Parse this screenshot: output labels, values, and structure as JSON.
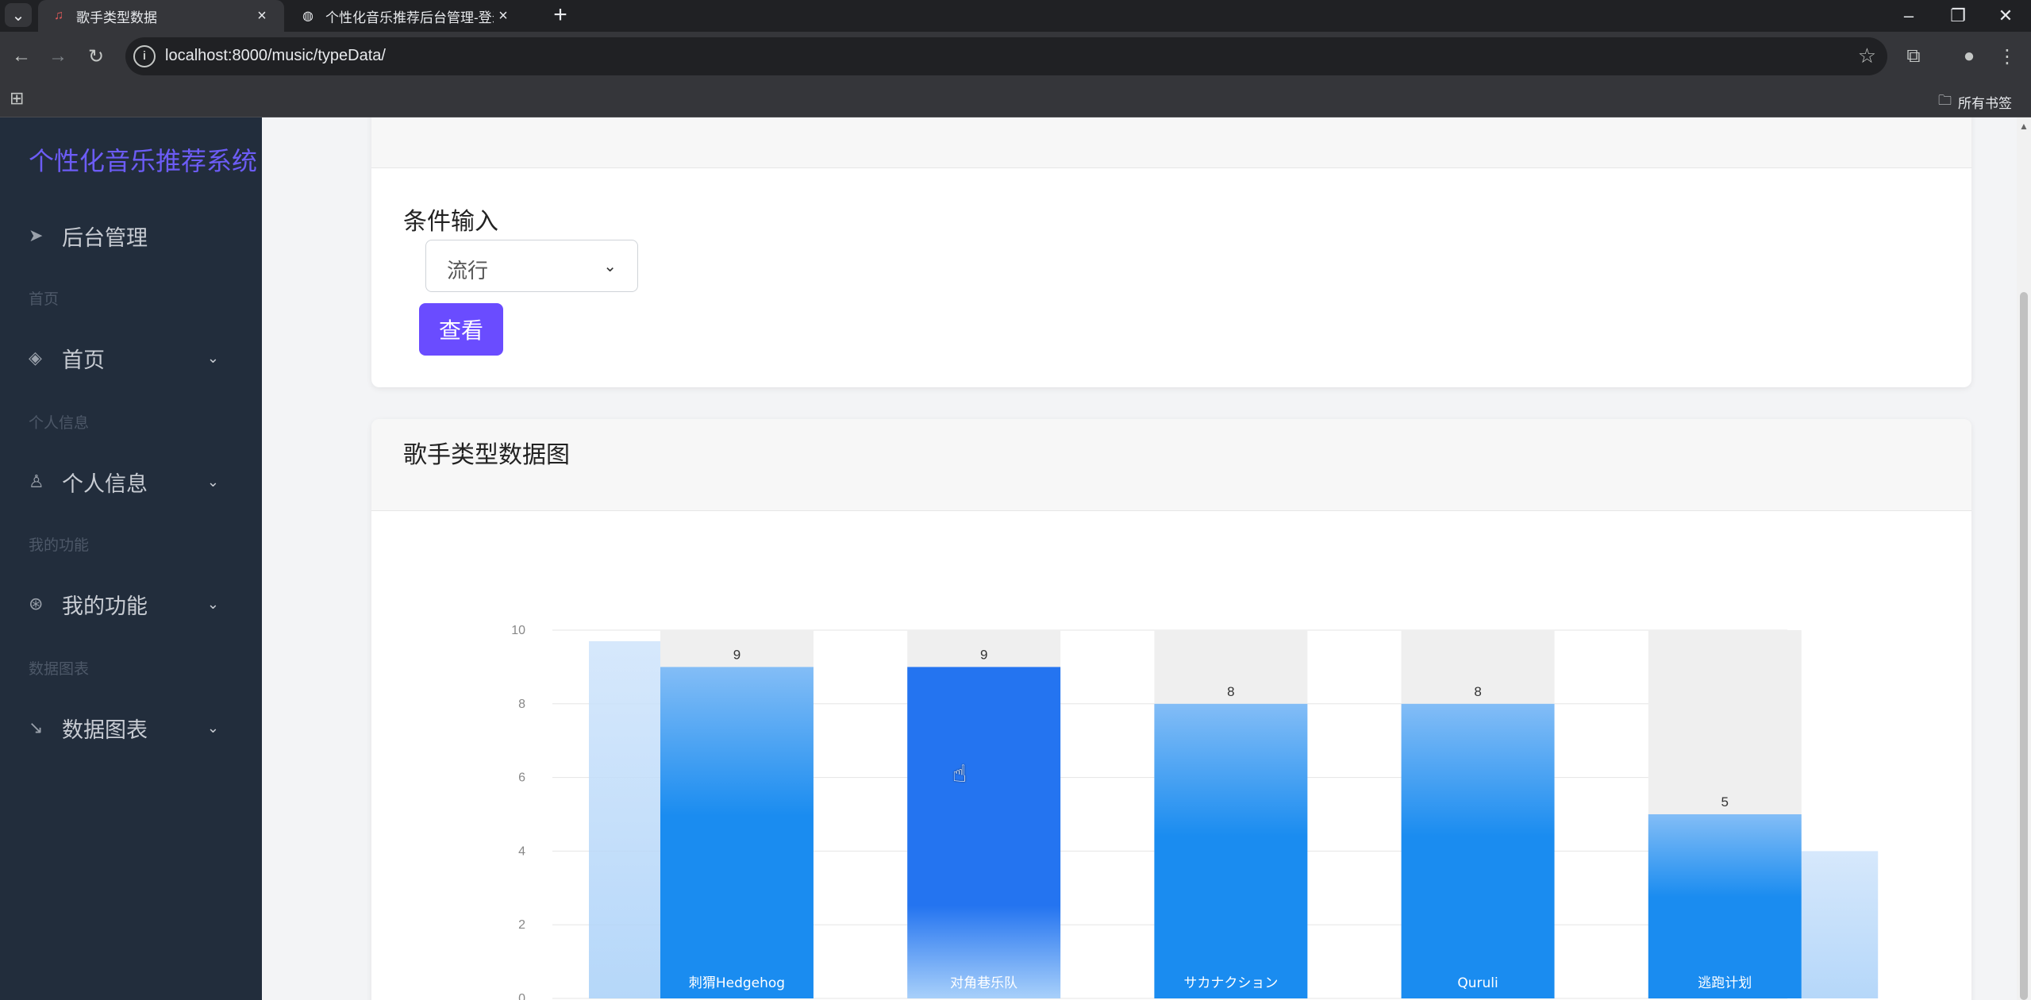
{
  "browser": {
    "tabs": [
      {
        "title": "歌手类型数据",
        "active": true,
        "favicon": "music-app-icon"
      },
      {
        "title": "个性化音乐推荐后台管理-登录",
        "active": false,
        "favicon": "globe-icon"
      }
    ],
    "url": "localhost:8000/music/typeData/",
    "bookmarks_all": "所有书签"
  },
  "sidebar": {
    "brand": "个性化音乐推荐系统",
    "top_item": "后台管理",
    "sections": [
      {
        "header": "首页",
        "item": "首页",
        "icon": "layers-icon"
      },
      {
        "header": "个人信息",
        "item": "个人信息",
        "icon": "user-icon"
      },
      {
        "header": "我的功能",
        "item": "我的功能",
        "icon": "aperture-icon"
      },
      {
        "header": "数据图表",
        "item": "数据图表",
        "icon": "trending-down-icon"
      }
    ]
  },
  "filter": {
    "title": "条件输入",
    "selected": "流行",
    "button": "查看"
  },
  "chart_card": {
    "title": "歌手类型数据图"
  },
  "colors": {
    "accent": "#6a4cff",
    "bar": "#1a8cf0",
    "bar_hover": "#2474f0",
    "sidebar": "#222d3c"
  },
  "chart_data": {
    "type": "bar",
    "categories": [
      "刺猬Hedgehog",
      "对角巷乐队",
      "サカナクション",
      "Quruli",
      "逃跑计划"
    ],
    "values": [
      9,
      9,
      8,
      8,
      5
    ],
    "yticks": [
      0,
      2,
      4,
      6,
      8,
      10
    ],
    "ylim": [
      0,
      10
    ],
    "background_bars": true,
    "highlighted_index": 1
  }
}
